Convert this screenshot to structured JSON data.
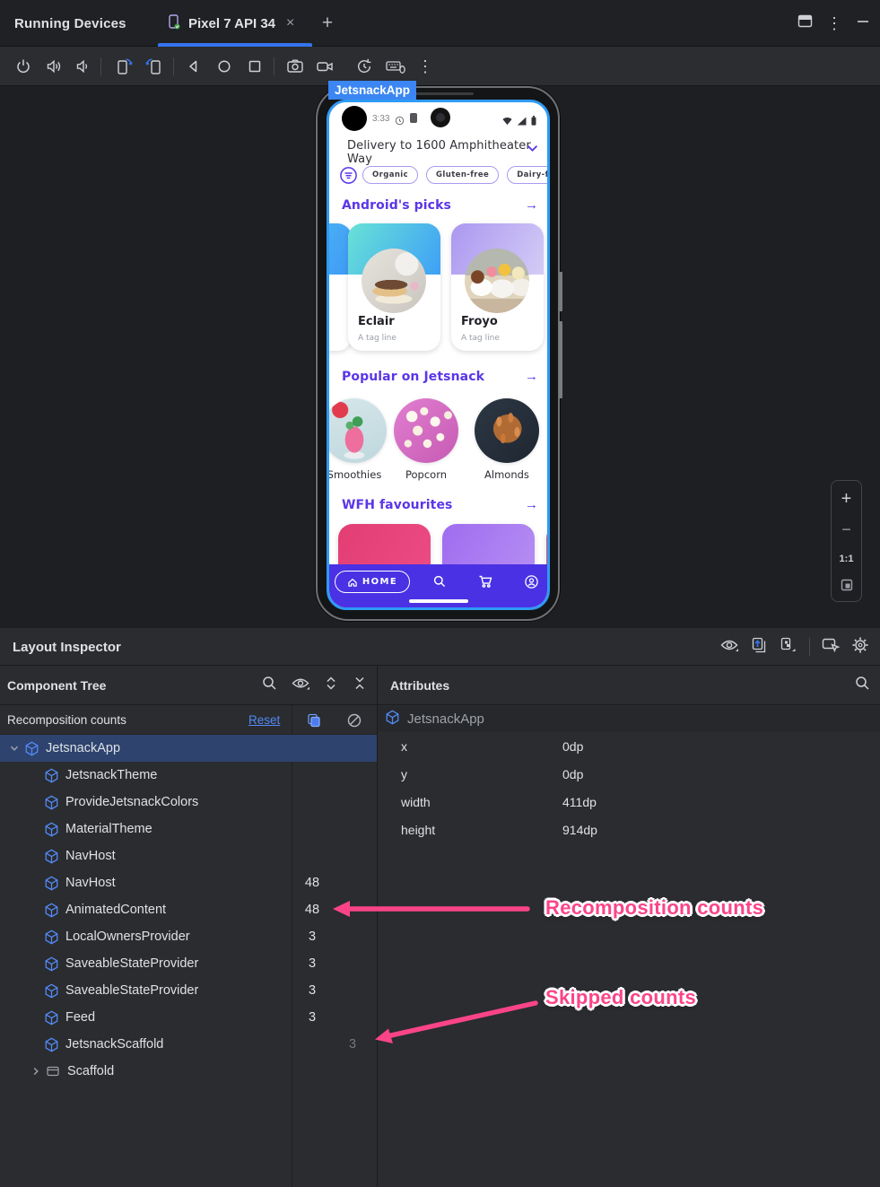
{
  "tab_bar": {
    "title": "Running Devices",
    "device_tab_label": "Pixel 7 API 34",
    "close_glyph": "×",
    "plus_glyph": "+",
    "more_glyph": "⋮"
  },
  "device": {
    "overlay_label": "JetsnackApp",
    "status_time": "3:33",
    "delivery_label": "Delivery to 1600 Amphitheater Way",
    "filters": [
      "Organic",
      "Gluten-free",
      "Dairy-free"
    ],
    "sections": {
      "picks": {
        "title": "Android's picks",
        "arrow": "→",
        "items": [
          {
            "name": "Eclair",
            "tagline": "A tag line"
          },
          {
            "name": "Froyo",
            "tagline": "A tag line"
          }
        ]
      },
      "popular": {
        "title": "Popular on Jetsnack",
        "arrow": "→",
        "items": [
          {
            "name": "Smoothies"
          },
          {
            "name": "Popcorn"
          },
          {
            "name": "Almonds"
          }
        ]
      },
      "wfh": {
        "title": "WFH favourites",
        "arrow": "→"
      }
    },
    "nav_home_label": "HOME"
  },
  "zoom_controls": {
    "zoom_in": "+",
    "zoom_out": "−",
    "actual_size": "1:1"
  },
  "inspector": {
    "title": "Layout Inspector",
    "tree_panel": {
      "title": "Component Tree",
      "recomposition_label": "Recomposition counts",
      "reset_label": "Reset",
      "nodes": [
        {
          "label": "JetsnackApp",
          "indent": 6,
          "chevron": "down",
          "icon": "compose",
          "selected": true,
          "count": "",
          "skipped": ""
        },
        {
          "label": "JetsnackTheme",
          "indent": 48,
          "icon": "compose",
          "count": "",
          "skipped": ""
        },
        {
          "label": "ProvideJetsnackColors",
          "indent": 48,
          "icon": "compose",
          "count": "",
          "skipped": ""
        },
        {
          "label": "MaterialTheme",
          "indent": 48,
          "icon": "compose",
          "count": "",
          "skipped": ""
        },
        {
          "label": "NavHost",
          "indent": 48,
          "icon": "compose",
          "count": "",
          "skipped": ""
        },
        {
          "label": "NavHost",
          "indent": 48,
          "icon": "compose",
          "count": "48",
          "skipped": ""
        },
        {
          "label": "AnimatedContent",
          "indent": 48,
          "icon": "compose",
          "count": "48",
          "skipped": ""
        },
        {
          "label": "LocalOwnersProvider",
          "indent": 48,
          "icon": "compose",
          "count": "3",
          "skipped": ""
        },
        {
          "label": "SaveableStateProvider",
          "indent": 48,
          "icon": "compose",
          "count": "3",
          "skipped": ""
        },
        {
          "label": "SaveableStateProvider",
          "indent": 48,
          "icon": "compose",
          "count": "3",
          "skipped": ""
        },
        {
          "label": "Feed",
          "indent": 48,
          "icon": "compose",
          "count": "3",
          "skipped": ""
        },
        {
          "label": "JetsnackScaffold",
          "indent": 48,
          "icon": "compose",
          "count": "",
          "skipped": "3"
        },
        {
          "label": "Scaffold",
          "indent": 30,
          "chevron": "right",
          "icon": "view",
          "count": "",
          "skipped": ""
        }
      ]
    },
    "attributes_panel": {
      "title": "Attributes",
      "component": "JetsnackApp",
      "properties": [
        {
          "name": "x",
          "value": "0dp"
        },
        {
          "name": "y",
          "value": "0dp"
        },
        {
          "name": "width",
          "value": "411dp"
        },
        {
          "name": "height",
          "value": "914dp"
        }
      ]
    }
  },
  "annotations": {
    "recomposition": "Recomposition counts",
    "skipped": "Skipped counts"
  },
  "colors": {
    "accent_blue": "#3574f0",
    "annotation_pink": "#fb4488",
    "jetsnack_purple": "#5a36e8",
    "nav_indigo": "#4a31e4",
    "selection_blue": "#2e436e",
    "check_green": "#5fb865"
  }
}
